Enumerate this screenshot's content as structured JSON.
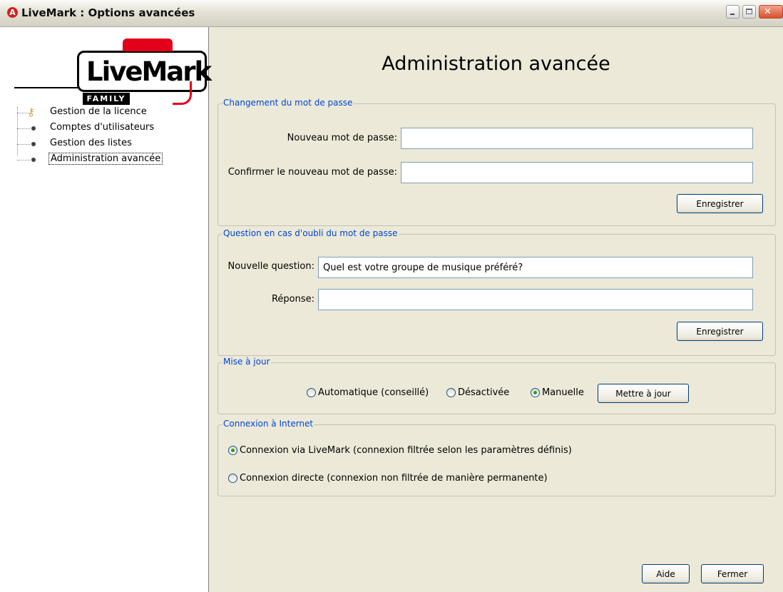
{
  "window": {
    "app_icon": "A",
    "title": "LiveMark : Options avancées"
  },
  "logo": {
    "text": "LiveMark",
    "sub": "FAMILY",
    "accent_color": "#e2001a"
  },
  "tree": {
    "items": [
      {
        "label": "Gestion de la licence",
        "icon": "key-icon",
        "selected": false
      },
      {
        "label": "Comptes d'utilisateurs",
        "icon": "bullet",
        "selected": false
      },
      {
        "label": "Gestion des listes",
        "icon": "bullet",
        "selected": false
      },
      {
        "label": "Administration avancée",
        "icon": "bullet",
        "selected": true
      }
    ]
  },
  "page": {
    "title": "Administration avancée"
  },
  "password_section": {
    "legend": "Changement du mot de passe",
    "new_label": "Nouveau mot de passe:",
    "new_value": "",
    "confirm_label": "Confirmer le nouveau mot de passe:",
    "confirm_value": "",
    "save_label": "Enregistrer"
  },
  "question_section": {
    "legend": "Question en cas d'oubli du mot de passe",
    "question_label": "Nouvelle question:",
    "question_value": "Quel est votre groupe de musique préféré?",
    "answer_label": "Réponse:",
    "answer_value": "",
    "save_label": "Enregistrer"
  },
  "update_section": {
    "legend": "Mise à jour",
    "options": [
      {
        "label": "Automatique (conseillé)",
        "checked": false
      },
      {
        "label": "Désactivée",
        "checked": false
      },
      {
        "label": "Manuelle",
        "checked": true
      }
    ],
    "update_button": "Mettre à jour"
  },
  "internet_section": {
    "legend": "Connexion à Internet",
    "options": [
      {
        "label": "Connexion via LiveMark (connexion filtrée selon les paramètres définis)",
        "checked": true
      },
      {
        "label": "Connexion directe (connexion non filtrée de manière permanente)",
        "checked": false
      }
    ]
  },
  "footer": {
    "help_label": "Aide",
    "close_label": "Fermer"
  },
  "colors": {
    "legend_blue": "#0046d5",
    "window_bg": "#ece9d8",
    "radio_checked": "#21a121",
    "close_button": "#d9512c"
  }
}
